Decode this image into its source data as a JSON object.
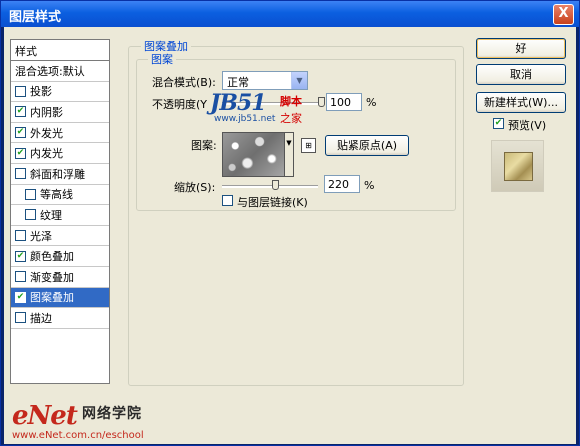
{
  "window": {
    "title": "图层样式",
    "close_label": "X"
  },
  "style_list": {
    "header": "样式",
    "blend_options": "混合选项:默认",
    "items": [
      {
        "label": "投影",
        "checked": false,
        "indent": false,
        "selected": false
      },
      {
        "label": "内阴影",
        "checked": true,
        "indent": false,
        "selected": false
      },
      {
        "label": "外发光",
        "checked": true,
        "indent": false,
        "selected": false
      },
      {
        "label": "内发光",
        "checked": true,
        "indent": false,
        "selected": false
      },
      {
        "label": "斜面和浮雕",
        "checked": false,
        "indent": false,
        "selected": false
      },
      {
        "label": "等高线",
        "checked": false,
        "indent": true,
        "selected": false
      },
      {
        "label": "纹理",
        "checked": false,
        "indent": true,
        "selected": false
      },
      {
        "label": "光泽",
        "checked": false,
        "indent": false,
        "selected": false
      },
      {
        "label": "颜色叠加",
        "checked": true,
        "indent": false,
        "selected": false
      },
      {
        "label": "渐变叠加",
        "checked": false,
        "indent": false,
        "selected": false
      },
      {
        "label": "图案叠加",
        "checked": true,
        "indent": false,
        "selected": true
      },
      {
        "label": "描边",
        "checked": false,
        "indent": false,
        "selected": false
      }
    ]
  },
  "panel": {
    "group_title": "图案叠加",
    "subgroup_title": "图案",
    "blend_mode_label": "混合模式(B):",
    "blend_mode_value": "正常",
    "opacity_label": "不透明度(Y",
    "opacity_value": "100",
    "opacity_unit": "%",
    "opacity_level": 1.0,
    "pattern_label": "图案:",
    "snap_origin_label": "贴紧原点(A)",
    "scale_label": "缩放(S):",
    "scale_value": "220",
    "scale_unit": "%",
    "link_label": "与图层链接(K)",
    "link_checked": false
  },
  "buttons": {
    "ok": "好",
    "cancel": "取消",
    "new_style": "新建样式(W)...",
    "preview_label": "预览(V)",
    "preview_checked": true
  },
  "watermark": {
    "logo": "JB51",
    "red_text": "脚本",
    "url": "www.jb51.net",
    "red_text2": "之家"
  },
  "footer_brand": {
    "logo": "eNet",
    "chinese": "网络学院",
    "url": "www.eNet.com.cn/eschool"
  },
  "colors": {
    "title_bar": "#0b5fe0",
    "selection": "#316ac5",
    "group_label": "#0046d5"
  }
}
